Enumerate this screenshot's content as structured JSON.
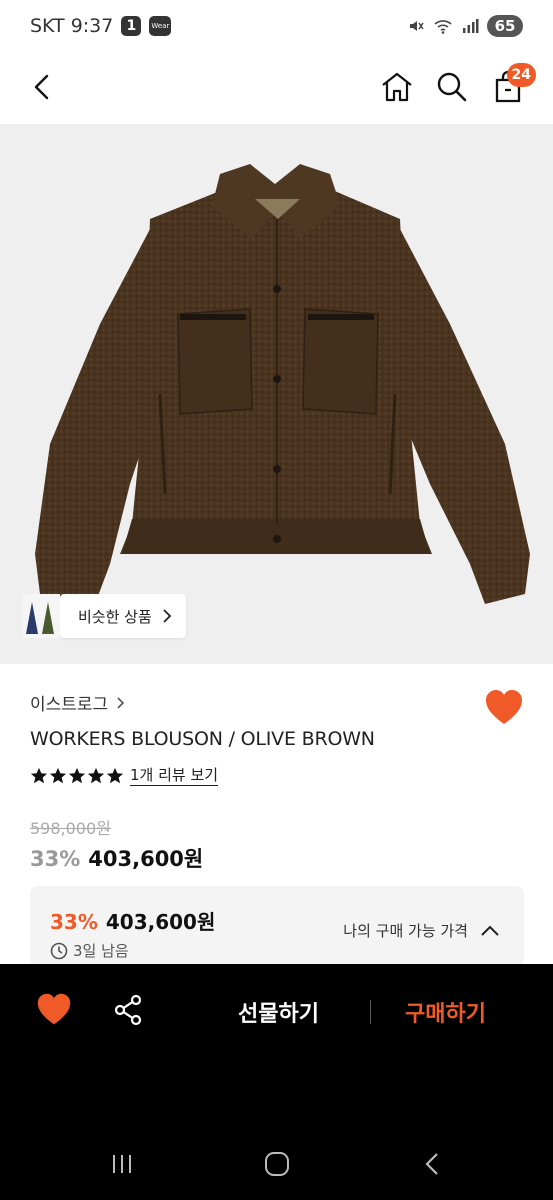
{
  "status_bar": {
    "carrier_time": "SKT 9:37",
    "badge": "1",
    "app_label": "Wear",
    "battery": "65"
  },
  "header": {
    "cart_count": "24"
  },
  "similar_products": {
    "label": "비슷한 상품"
  },
  "product": {
    "brand": "이스트로그",
    "title": "WORKERS BLOUSON / OLIVE BROWN",
    "rating_stars": 5,
    "review_link": "1개 리뷰 보기",
    "original_price": "598,000원",
    "discount": "33%",
    "price": "403,600원"
  },
  "benefit": {
    "discount": "33%",
    "price": "403,600원",
    "time_left": "3일 남음",
    "label": "나의 구매 가능 가격"
  },
  "bottom_bar": {
    "gift_label": "선물하기",
    "buy_label": "구매하기"
  },
  "colors": {
    "accent": "#f05a28",
    "jacket": "#4a3420"
  },
  "icons": [
    "back-icon",
    "home-icon",
    "search-icon",
    "cart-icon",
    "heart-icon",
    "share-icon",
    "clock-icon",
    "chevron-up-icon",
    "chevron-right-icon",
    "star-icon"
  ]
}
